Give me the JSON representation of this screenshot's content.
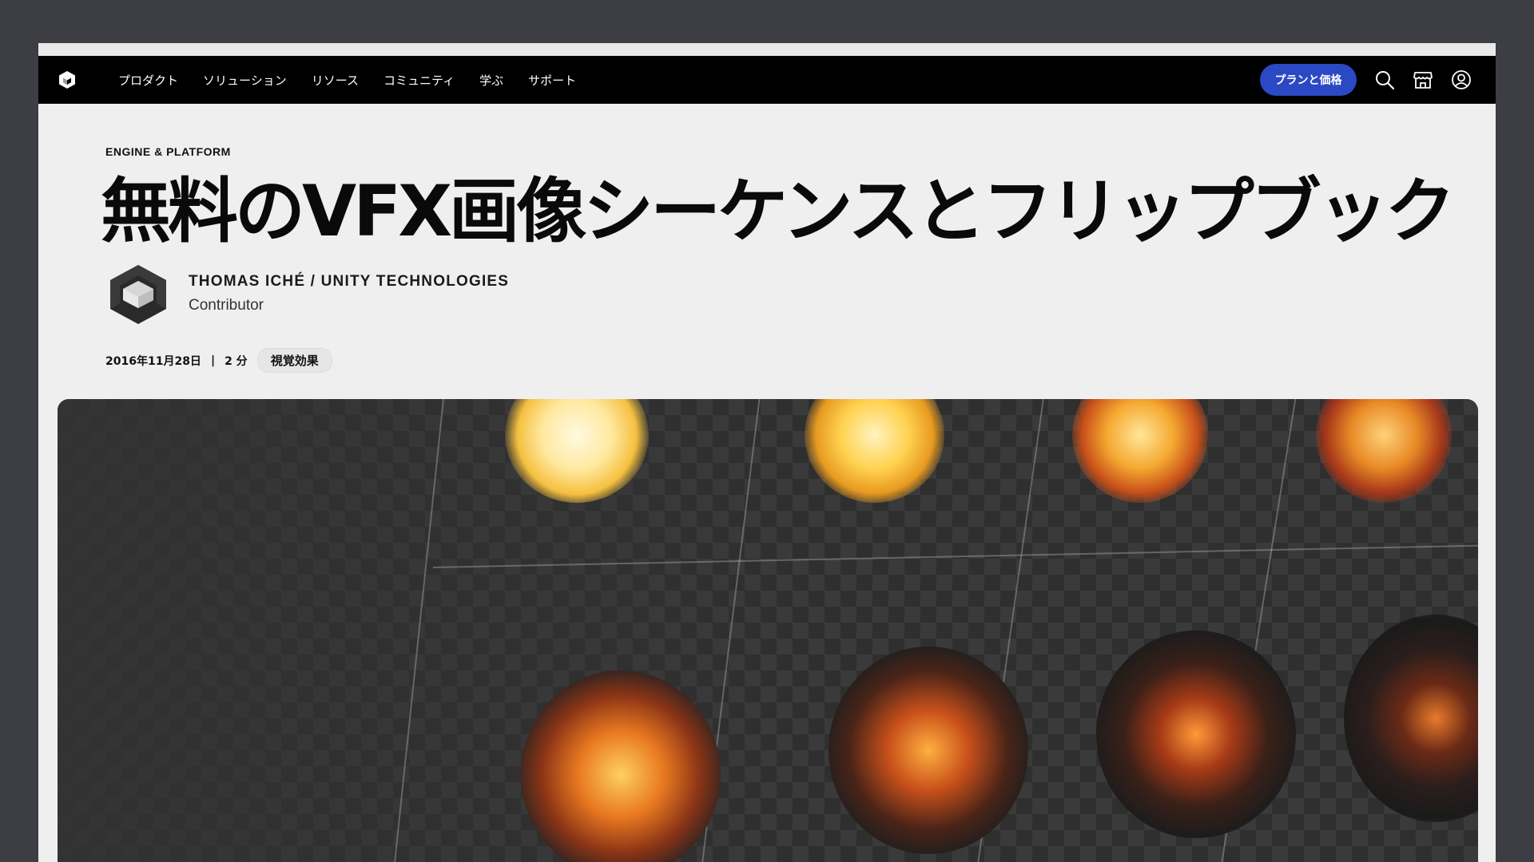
{
  "nav": {
    "items": [
      "プロダクト",
      "ソリューション",
      "リソース",
      "コミュニティ",
      "学ぶ",
      "サポート"
    ],
    "plan_button": "プランと価格",
    "icons": [
      "unity-logo-icon",
      "search-icon",
      "store-icon",
      "account-icon"
    ],
    "accent": "#2b49c4"
  },
  "article": {
    "category": "ENGINE & PLATFORM",
    "title": "無料のVFX画像シーケンスとフリップブック",
    "author": {
      "name": "THOMAS ICHÉ / UNITY TECHNOLOGIES",
      "role": "Contributor"
    },
    "date": "2016年11月28日",
    "separator": "|",
    "read_time": "2 分",
    "tag": "視覚効果"
  }
}
